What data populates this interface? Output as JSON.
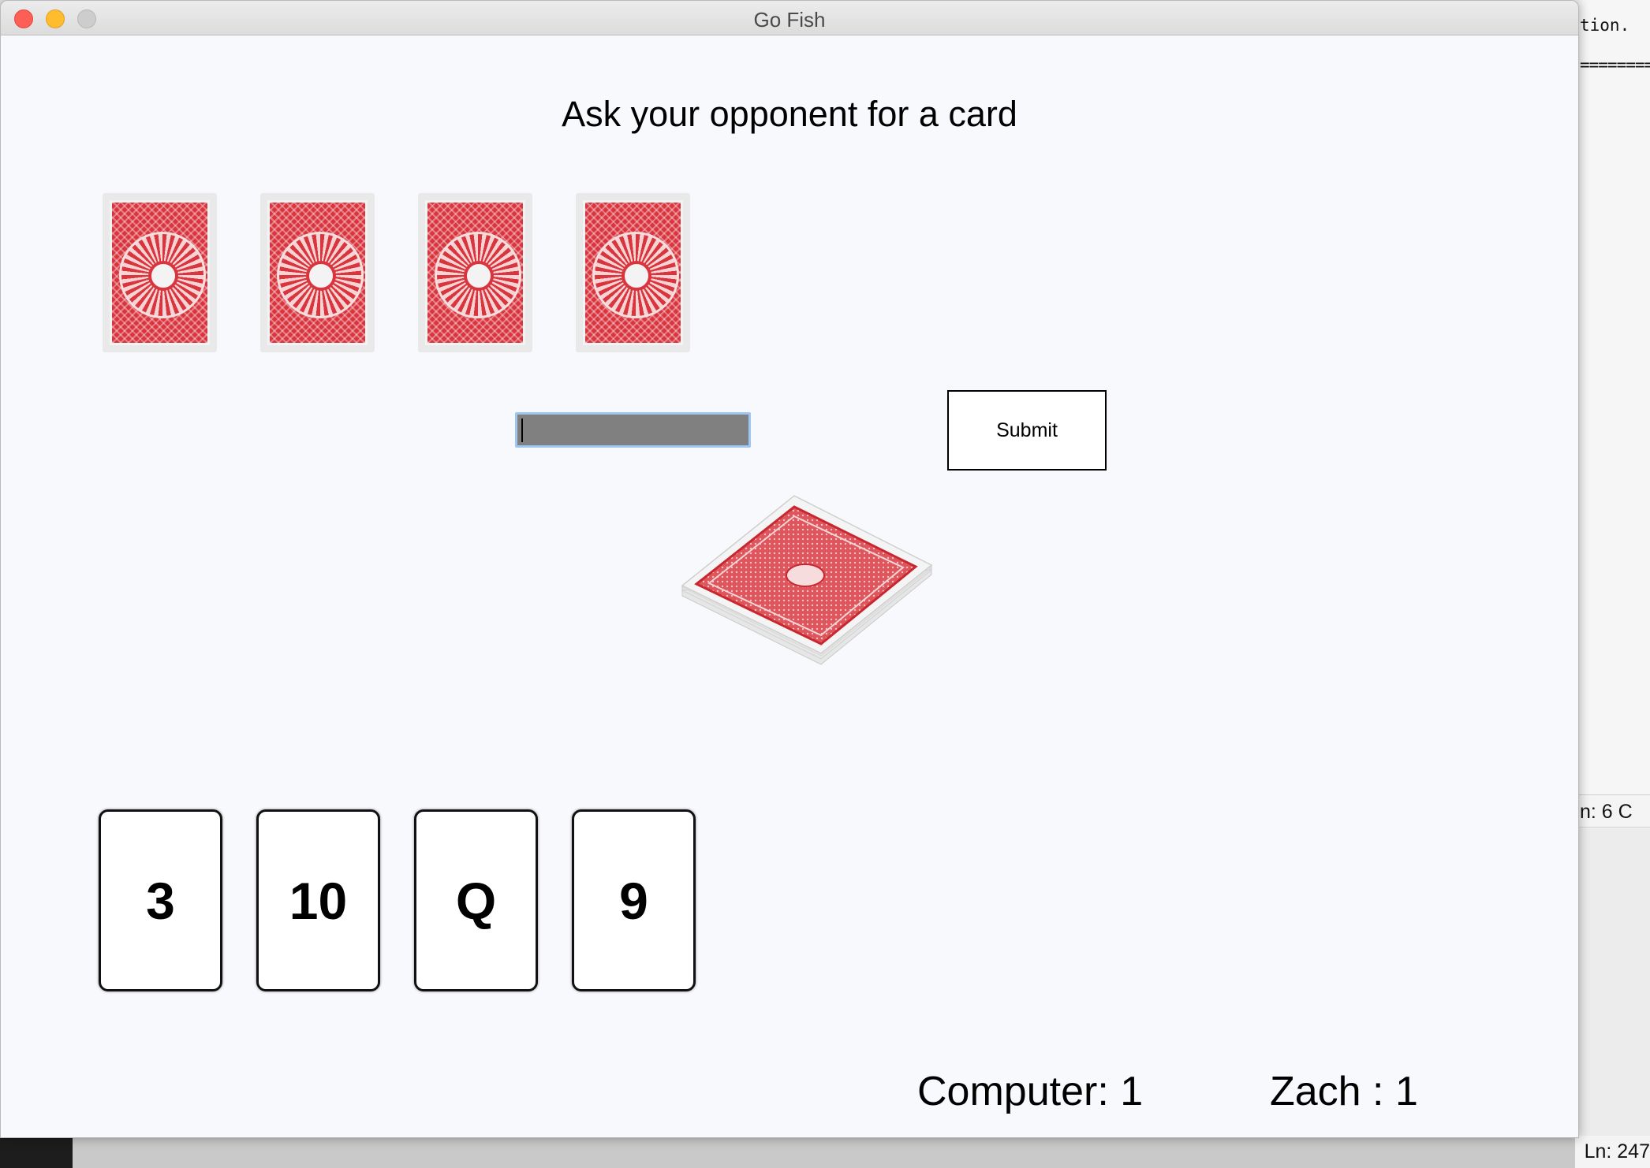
{
  "window": {
    "title": "Go Fish"
  },
  "game": {
    "prompt": "Ask your opponent for a card",
    "opponent_hand": {
      "card_count": 4,
      "card_back": "red-back"
    },
    "ask_input": {
      "value": "",
      "placeholder": ""
    },
    "submit_label": "Submit",
    "deck_icon": "card-deck",
    "player_hand": [
      "3",
      "10",
      "Q",
      "9"
    ],
    "scores": {
      "computer": "Computer: 1",
      "player": "Zach : 1"
    }
  },
  "background_editor": {
    "text_line_1": "tion.",
    "text_line_2": "========",
    "status_1": "n: 6   C",
    "status_2": "Ln: 247"
  },
  "colors": {
    "window_bg": "#f8f9fd",
    "card_back_red": "#d9353e",
    "input_bg": "#808080",
    "input_focus_ring": "#9fc6f1"
  }
}
